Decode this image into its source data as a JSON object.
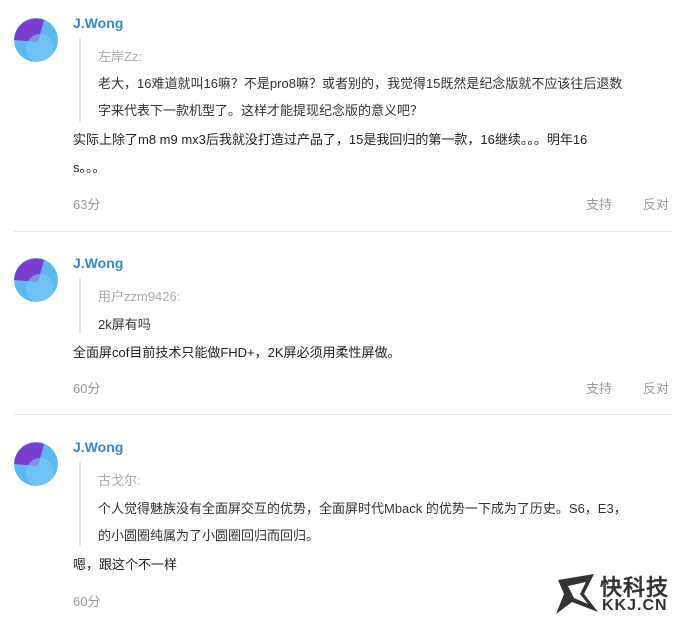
{
  "comments": [
    {
      "username": "J.Wong",
      "quote_author": "左岸Zz:",
      "quote_lines": [
        "老大，16难道就叫16嘛？不是pro8嘛？或者别的，我觉得15既然是纪念版就不应该往后退数",
        "字来代表下一款机型了。这样才能提现纪念版的意义吧？"
      ],
      "body_lines": [
        "实际上除了m8 m9 mx3后我就没打造过产品了，15是我回归的第一款，16继续。。。明年16",
        "s。。。"
      ],
      "score": "63分",
      "support": "支持",
      "oppose": "反对"
    },
    {
      "username": "J.Wong",
      "quote_author": "用户zzm9426:",
      "quote_lines": [
        "2k屏有吗"
      ],
      "body_lines": [
        "全面屏cof目前技术只能做FHD+，2K屏必须用柔性屏做。"
      ],
      "score": "60分",
      "support": "支持",
      "oppose": "反对"
    },
    {
      "username": "J.Wong",
      "quote_author": "古戈尔:",
      "quote_lines": [
        "个人觉得魅族没有全面屏交互的优势，全面屏时代Mback 的优势一下成为了历史。S6，E3，",
        "的小圆圈纯属为了小圆圈回归而回归。"
      ],
      "body_lines": [
        "嗯，跟这个不一样"
      ],
      "score": "60分"
    }
  ],
  "watermark": {
    "title": "快科技",
    "subtitle": "KKJ.CN"
  },
  "colors": {
    "username": "#3388dd",
    "muted": "#999999",
    "avatar_blue": "#5bb8f2",
    "avatar_purple": "#7a3fd0"
  }
}
